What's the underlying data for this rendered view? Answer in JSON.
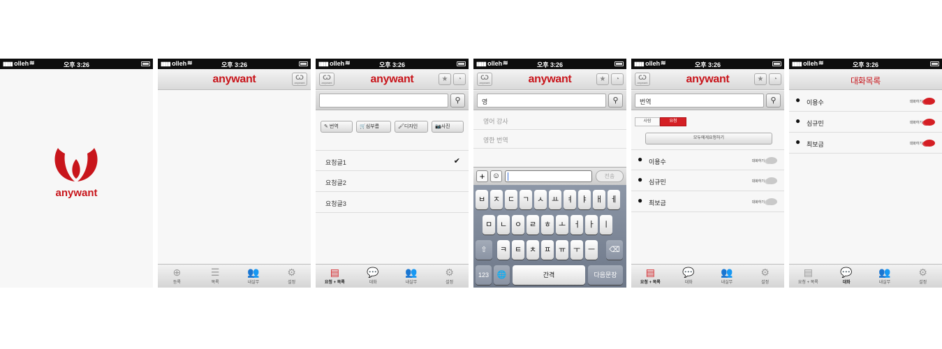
{
  "status": {
    "carrier": "olleh",
    "time": "오후 3:26"
  },
  "brand": {
    "name": "anywant",
    "small_logo": "anywant",
    "color": "#c8151b"
  },
  "screens": [
    {
      "id": "splash"
    },
    {
      "id": "home",
      "title": "anywant",
      "tabs": [
        {
          "label": "등록",
          "icon": "plus-circle-icon"
        },
        {
          "label": "목록",
          "icon": "list-icon"
        },
        {
          "label": "내실무",
          "icon": "people-icon"
        },
        {
          "label": "설정",
          "icon": "gear-icon"
        }
      ]
    },
    {
      "id": "request",
      "title": "anywant",
      "categories": [
        "번역",
        "심부름",
        "디자인",
        "사진"
      ],
      "items": [
        "요청글1",
        "요청글2",
        "요청글3"
      ],
      "tabs": [
        {
          "label": "요청 + 목록"
        },
        {
          "label": "대화"
        },
        {
          "label": "내실무"
        },
        {
          "label": "설정"
        }
      ]
    },
    {
      "id": "search-keyboard",
      "title": "anywant",
      "search_value": "영",
      "suggestions": [
        "영어 강사",
        "영한 번역"
      ],
      "send_label": "전송",
      "keyboard": {
        "row1": [
          "ㅂ",
          "ㅈ",
          "ㄷ",
          "ㄱ",
          "ㅅ",
          "ㅛ",
          "ㅕ",
          "ㅑ",
          "ㅐ",
          "ㅔ"
        ],
        "row2": [
          "ㅁ",
          "ㄴ",
          "ㅇ",
          "ㄹ",
          "ㅎ",
          "ㅗ",
          "ㅓ",
          "ㅏ",
          "ㅣ"
        ],
        "row3": [
          "ㅋ",
          "ㅌ",
          "ㅊ",
          "ㅍ",
          "ㅠ",
          "ㅜ",
          "ㅡ"
        ],
        "numbers": "123",
        "space": "간격",
        "next": "다음문장"
      }
    },
    {
      "id": "search-results",
      "title": "anywant",
      "search_value": "번역",
      "segments": [
        "사람",
        "요청"
      ],
      "request_all": "모두에게요청하기",
      "people": [
        "이용수",
        "심규민",
        "최보금"
      ],
      "chat_label": "대화하기",
      "tabs": [
        {
          "label": "요청 + 목록"
        },
        {
          "label": "대화"
        },
        {
          "label": "내실무"
        },
        {
          "label": "설정"
        }
      ]
    },
    {
      "id": "chat-list",
      "title": "대화목록",
      "people": [
        "이용수",
        "심규민",
        "최보금"
      ],
      "chat_label": "대화하기",
      "tabs": [
        {
          "label": "요청 + 목록"
        },
        {
          "label": "대화"
        },
        {
          "label": "내실무"
        },
        {
          "label": "설정"
        }
      ]
    }
  ]
}
